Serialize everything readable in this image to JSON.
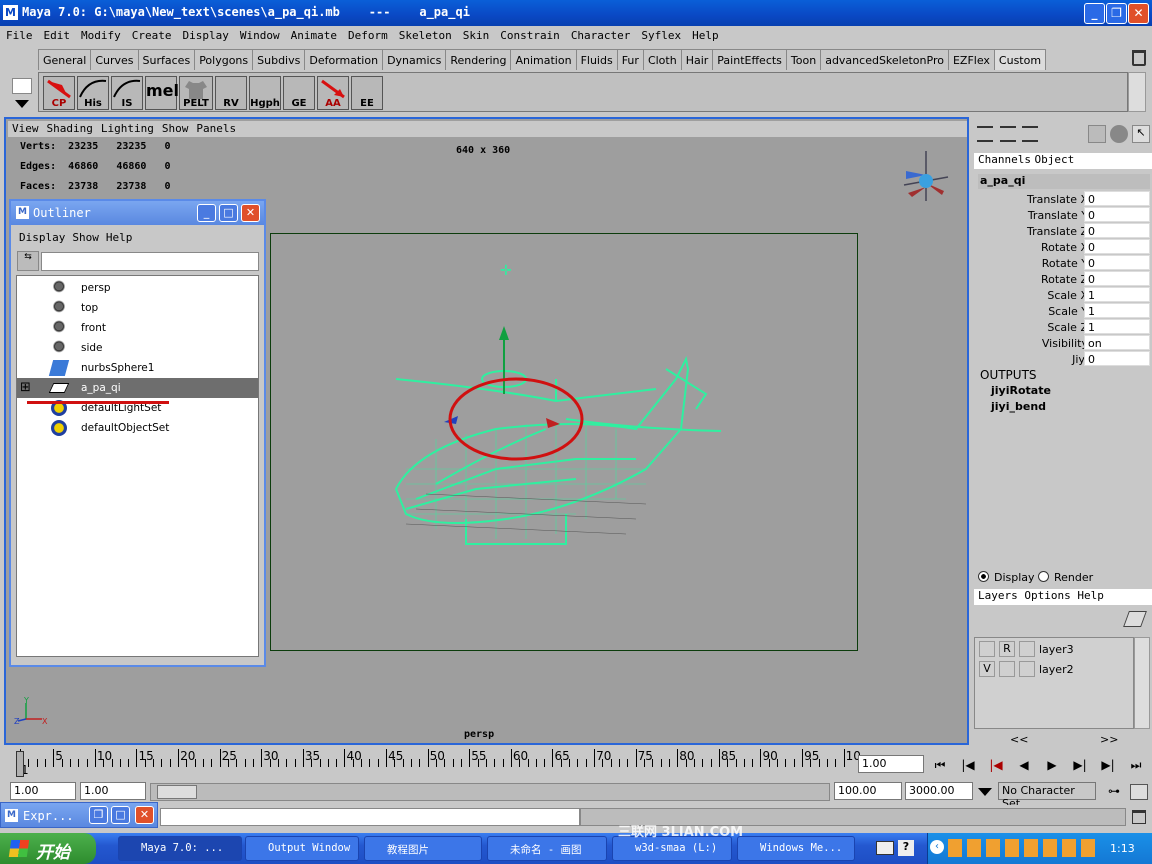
{
  "window": {
    "title": "Maya 7.0: G:\\maya\\New_text\\scenes\\a_pa_qi.mb    ---    a_pa_qi"
  },
  "menubar": [
    "File",
    "Edit",
    "Modify",
    "Create",
    "Display",
    "Window",
    "Animate",
    "Deform",
    "Skeleton",
    "Skin",
    "Constrain",
    "Character",
    "Syflex",
    "Help"
  ],
  "shelf_tabs": [
    "General",
    "Curves",
    "Surfaces",
    "Polygons",
    "Subdivs",
    "Deformation",
    "Dynamics",
    "Rendering",
    "Animation",
    "Fluids",
    "Fur",
    "Cloth",
    "Hair",
    "PaintEffects",
    "Toon",
    "advancedSkeletonPro",
    "EZFlex",
    "Custom"
  ],
  "shelf_buttons": [
    "CP",
    "His",
    "IS",
    "mel",
    "PELT",
    "RV",
    "Hgph",
    "GE",
    "AA",
    "EE"
  ],
  "viewport": {
    "menu": [
      "View",
      "Shading",
      "Lighting",
      "Show",
      "Panels"
    ],
    "hud": {
      "verts_label": "Verts:",
      "verts": [
        "23235",
        "23235",
        "0"
      ],
      "edges_label": "Edges:",
      "edges": [
        "46860",
        "46860",
        "0"
      ],
      "faces_label": "Faces:",
      "faces": [
        "23738",
        "23738",
        "0"
      ],
      "resolution": "640 x 360",
      "camera": "persp"
    },
    "axis": {
      "y": "Y",
      "z": "Z",
      "x": "X"
    }
  },
  "outliner": {
    "title": "Outliner",
    "menu": [
      "Display",
      "Show",
      "Help"
    ],
    "items": [
      {
        "label": "persp",
        "icon": "camera-icon"
      },
      {
        "label": "top",
        "icon": "camera-icon"
      },
      {
        "label": "front",
        "icon": "camera-icon"
      },
      {
        "label": "side",
        "icon": "camera-icon"
      },
      {
        "label": "nurbsSphere1",
        "icon": "nurbs-surface-icon"
      },
      {
        "label": "a_pa_qi",
        "icon": "mesh-icon",
        "selected": true,
        "expand": "⊞"
      },
      {
        "label": "defaultLightSet",
        "icon": "set-icon"
      },
      {
        "label": "defaultObjectSet",
        "icon": "set-icon"
      }
    ]
  },
  "channel_box": {
    "tabs": [
      "Channels",
      "Object"
    ],
    "object": "a_pa_qi",
    "attrs": [
      {
        "name": "Translate X",
        "value": "0"
      },
      {
        "name": "Translate Y",
        "value": "0"
      },
      {
        "name": "Translate Z",
        "value": "0"
      },
      {
        "name": "Rotate X",
        "value": "0"
      },
      {
        "name": "Rotate Y",
        "value": "0"
      },
      {
        "name": "Rotate Z",
        "value": "0"
      },
      {
        "name": "Scale X",
        "value": "1"
      },
      {
        "name": "Scale Y",
        "value": "1"
      },
      {
        "name": "Scale Z",
        "value": "1"
      },
      {
        "name": "Visibility",
        "value": "on"
      },
      {
        "name": "Jiyi",
        "value": "0"
      }
    ],
    "outputs_label": "OUTPUTS",
    "outputs": [
      "jiyiRotate",
      "jiyi_bend"
    ]
  },
  "layer_editor": {
    "display": "Display",
    "render": "Render",
    "menu": [
      "Layers",
      "Options",
      "Help"
    ],
    "layers": [
      {
        "v": "",
        "r": "R",
        "name": "layer3"
      },
      {
        "v": "V",
        "r": "",
        "name": "layer2"
      }
    ],
    "nav_left": "<<",
    "nav_right": ">>"
  },
  "time_slider": {
    "ticks": [
      "1",
      "5",
      "10",
      "15",
      "20",
      "25",
      "30",
      "35",
      "40",
      "45",
      "50",
      "55",
      "60",
      "65",
      "70",
      "75",
      "80",
      "85",
      "90",
      "95",
      "10"
    ],
    "current_time": "1.00"
  },
  "range_slider": {
    "start": "1.00",
    "range_start": "1.00",
    "range_end": "100.00",
    "end": "3000.00",
    "character_set": "No Character Set"
  },
  "expr_window": {
    "title": "Expr..."
  },
  "taskbar": {
    "start": "开始",
    "buttons": [
      "Maya 7.0: ...",
      "Output Window",
      "教程图片",
      "未命名 - 画图",
      "w3d-smaa (L:)",
      "Windows Me..."
    ],
    "clock": "1:13",
    "watermark": "三联网 3LIAN.COM"
  },
  "colors": {
    "wire": "#2ff0a0",
    "annotation": "#d01010",
    "selection": "#2a66d8"
  }
}
